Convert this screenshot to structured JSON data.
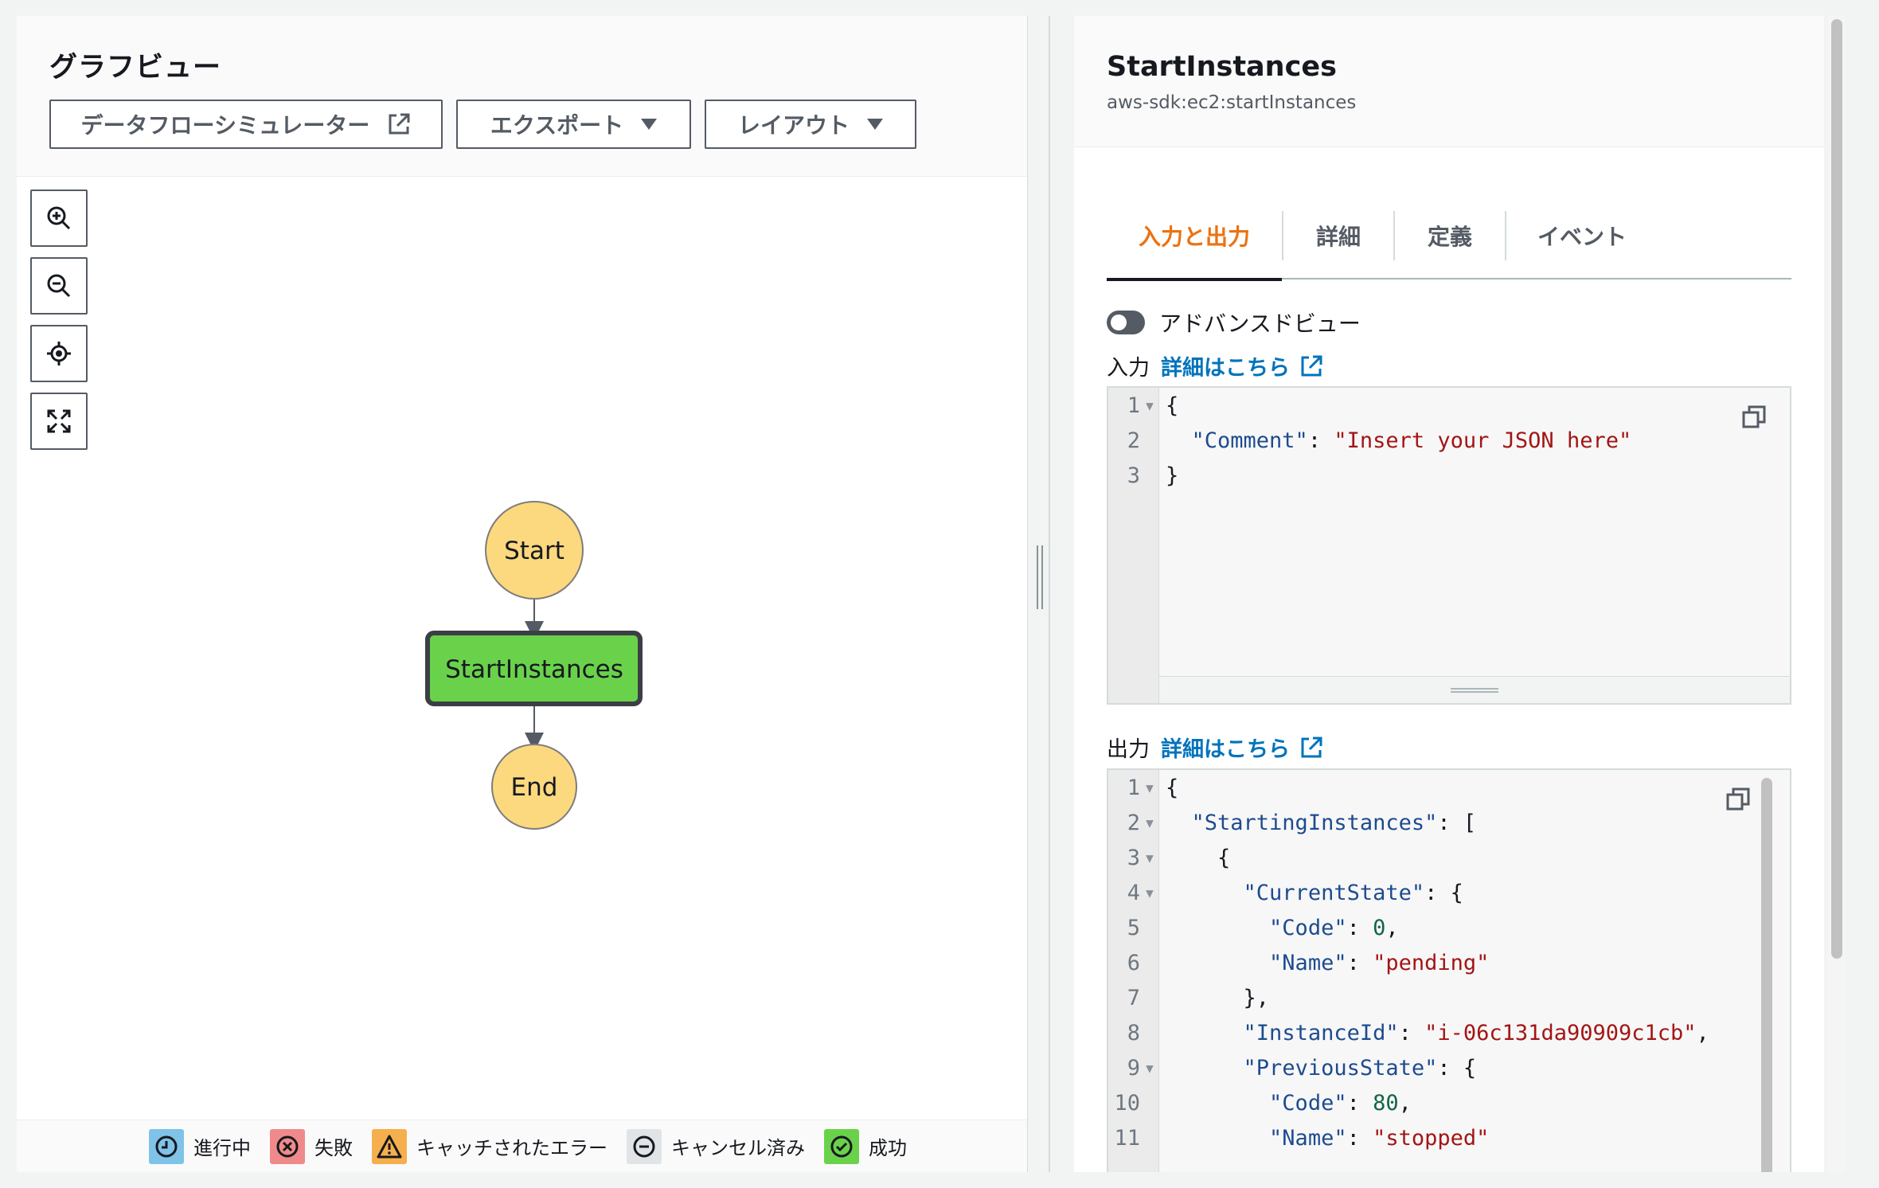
{
  "graph_panel": {
    "title": "グラフビュー",
    "toolbar": {
      "simulator_label": "データフローシミュレーター",
      "export_label": "エクスポート",
      "layout_label": "レイアウト"
    },
    "zoom_controls": [
      "zoom-in-icon",
      "zoom-out-icon",
      "center-icon",
      "fit-icon"
    ],
    "nodes": {
      "start": "Start",
      "task": "StartInstances",
      "end": "End"
    },
    "colors": {
      "terminal_fill": "#fcd97e",
      "task_fill": "#6ad24a",
      "task_border": "#3b3f45"
    },
    "legend": [
      {
        "label": "進行中",
        "color": "#7fc3e8",
        "icon": "clock-icon"
      },
      {
        "label": "失敗",
        "color": "#f08a8a",
        "icon": "x-circle-icon"
      },
      {
        "label": "キャッチされたエラー",
        "color": "#f5b04d",
        "icon": "warning-icon"
      },
      {
        "label": "キャンセル済み",
        "color": "#e1e4e6",
        "icon": "minus-circle-icon"
      },
      {
        "label": "成功",
        "color": "#6ad24a",
        "icon": "check-circle-icon"
      }
    ]
  },
  "detail_panel": {
    "state_name": "StartInstances",
    "resource": "aws-sdk:ec2:startInstances",
    "tabs": [
      {
        "label": "入力と出力",
        "active": true
      },
      {
        "label": "詳細",
        "active": false
      },
      {
        "label": "定義",
        "active": false
      },
      {
        "label": "イベント",
        "active": false
      }
    ],
    "advanced_view_label": "アドバンスドビュー",
    "advanced_view_on": false,
    "input": {
      "label": "入力",
      "info_link": "詳細はこちら",
      "lines": [
        {
          "n": "1",
          "fold": true,
          "parts": [
            {
              "t": "{",
              "c": "p"
            }
          ]
        },
        {
          "n": "2",
          "fold": false,
          "parts": [
            {
              "t": "  ",
              "c": "p"
            },
            {
              "t": "\"Comment\"",
              "c": "k"
            },
            {
              "t": ": ",
              "c": "p"
            },
            {
              "t": "\"Insert your JSON here\"",
              "c": "s"
            }
          ]
        },
        {
          "n": "3",
          "fold": false,
          "parts": [
            {
              "t": "}",
              "c": "p"
            }
          ]
        }
      ]
    },
    "output": {
      "label": "出力",
      "info_link": "詳細はこちら",
      "lines": [
        {
          "n": "1",
          "fold": true,
          "parts": [
            {
              "t": "{",
              "c": "p"
            }
          ]
        },
        {
          "n": "2",
          "fold": true,
          "parts": [
            {
              "t": "  ",
              "c": "p"
            },
            {
              "t": "\"StartingInstances\"",
              "c": "k"
            },
            {
              "t": ": [",
              "c": "p"
            }
          ]
        },
        {
          "n": "3",
          "fold": true,
          "parts": [
            {
              "t": "    {",
              "c": "p"
            }
          ]
        },
        {
          "n": "4",
          "fold": true,
          "parts": [
            {
              "t": "      ",
              "c": "p"
            },
            {
              "t": "\"CurrentState\"",
              "c": "k"
            },
            {
              "t": ": {",
              "c": "p"
            }
          ]
        },
        {
          "n": "5",
          "fold": false,
          "parts": [
            {
              "t": "        ",
              "c": "p"
            },
            {
              "t": "\"Code\"",
              "c": "k"
            },
            {
              "t": ": ",
              "c": "p"
            },
            {
              "t": "0",
              "c": "n"
            },
            {
              "t": ",",
              "c": "p"
            }
          ]
        },
        {
          "n": "6",
          "fold": false,
          "parts": [
            {
              "t": "        ",
              "c": "p"
            },
            {
              "t": "\"Name\"",
              "c": "k"
            },
            {
              "t": ": ",
              "c": "p"
            },
            {
              "t": "\"pending\"",
              "c": "s"
            }
          ]
        },
        {
          "n": "7",
          "fold": false,
          "parts": [
            {
              "t": "      },",
              "c": "p"
            }
          ]
        },
        {
          "n": "8",
          "fold": false,
          "parts": [
            {
              "t": "      ",
              "c": "p"
            },
            {
              "t": "\"InstanceId\"",
              "c": "k"
            },
            {
              "t": ": ",
              "c": "p"
            },
            {
              "t": "\"i-06c131da90909c1cb\"",
              "c": "s"
            },
            {
              "t": ",",
              "c": "p"
            }
          ]
        },
        {
          "n": "9",
          "fold": true,
          "parts": [
            {
              "t": "      ",
              "c": "p"
            },
            {
              "t": "\"PreviousState\"",
              "c": "k"
            },
            {
              "t": ": {",
              "c": "p"
            }
          ]
        },
        {
          "n": "10",
          "fold": false,
          "parts": [
            {
              "t": "        ",
              "c": "p"
            },
            {
              "t": "\"Code\"",
              "c": "k"
            },
            {
              "t": ": ",
              "c": "p"
            },
            {
              "t": "80",
              "c": "n"
            },
            {
              "t": ",",
              "c": "p"
            }
          ]
        },
        {
          "n": "11",
          "fold": false,
          "parts": [
            {
              "t": "        ",
              "c": "p"
            },
            {
              "t": "\"Name\"",
              "c": "k"
            },
            {
              "t": ": ",
              "c": "p"
            },
            {
              "t": "\"stopped\"",
              "c": "s"
            }
          ]
        }
      ]
    }
  },
  "colors": {
    "accent_tab": "#ec7211",
    "link": "#0073bb",
    "json_key": "#1d4b8f",
    "json_string": "#a31515",
    "json_number": "#116644"
  }
}
